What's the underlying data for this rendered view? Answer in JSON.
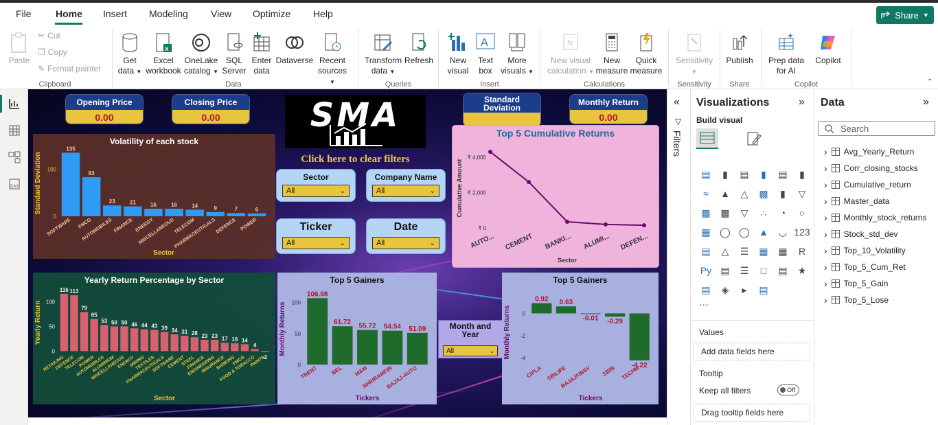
{
  "menu": {
    "items": [
      "File",
      "Home",
      "Insert",
      "Modeling",
      "View",
      "Optimize",
      "Help"
    ],
    "active": "Home",
    "share_label": "Share"
  },
  "ribbon": {
    "clipboard": {
      "paste": "Paste",
      "cut": "Cut",
      "copy": "Copy",
      "format_painter": "Format painter",
      "group": "Clipboard"
    },
    "data": {
      "get_data": "Get data",
      "excel": "Excel workbook",
      "onelake": "OneLake catalog",
      "sql": "SQL Server",
      "enter_data": "Enter data",
      "dataverse": "Dataverse",
      "recent": "Recent sources",
      "group": "Data"
    },
    "queries": {
      "transform": "Transform data",
      "refresh": "Refresh",
      "group": "Queries"
    },
    "insert": {
      "new_visual": "New visual",
      "text_box": "Text box",
      "more_visuals": "More visuals",
      "group": "Insert"
    },
    "calculations": {
      "new_visual_calc": "New visual calculation",
      "new_measure": "New measure",
      "quick_measure": "Quick measure",
      "group": "Calculations"
    },
    "sensitivity": {
      "label": "Sensitivity",
      "group": "Sensitivity"
    },
    "share": {
      "publish": "Publish",
      "group": "Share"
    },
    "copilot": {
      "prep": "Prep data for AI",
      "copilot": "Copilot",
      "group": "Copilot"
    }
  },
  "report": {
    "kpis": [
      {
        "title": "Opening Price",
        "value": "0.00"
      },
      {
        "title": "Closing Price",
        "value": "0.00"
      },
      {
        "title": "Standard Deviation",
        "value": ""
      },
      {
        "title": "Monthly Return",
        "value": "0.00"
      }
    ],
    "logo_text": "SMA",
    "clear_filters": "Click here to clear filters",
    "slicers": [
      {
        "title": "Sector",
        "value": "All"
      },
      {
        "title": "Company Name",
        "value": "All"
      },
      {
        "title": "Ticker",
        "value": "All"
      },
      {
        "title": "Date",
        "value": "All"
      }
    ],
    "month_year_slicer": {
      "title": "Month and Year",
      "value": "All"
    }
  },
  "chart_data": [
    {
      "type": "bar",
      "title": "Volatility of each stock",
      "xlabel": "Sector",
      "ylabel": "Standard Deviation",
      "categories": [
        "SOFTWARE",
        "FMCG",
        "AUTOMOBILES",
        "FINANCE",
        "ENERGY",
        "MISCELLANEOUS",
        "TELECOM",
        "PHARMACEUTICALS",
        "DEFENCE",
        "POWER"
      ],
      "values": [
        135,
        83,
        23,
        21,
        16,
        16,
        14,
        9,
        7,
        6
      ],
      "yticks": [
        "0",
        "100"
      ],
      "ylim": [
        0,
        140
      ]
    },
    {
      "type": "line",
      "title": "Top 5 Cumulative Returns",
      "xlabel": "Sector",
      "ylabel": "Cumulative Amount",
      "categories": [
        "AUTO...",
        "CEMENT",
        "BANKI...",
        "ALUMI...",
        "DEFEN..."
      ],
      "values": [
        4300,
        2600,
        350,
        200,
        150
      ],
      "yticks": [
        "₹ 0",
        "₹ 2,000",
        "₹ 4,000"
      ],
      "ylim": [
        0,
        4500
      ]
    },
    {
      "type": "bar",
      "title": "Yearly Return Percentage by Sector",
      "xlabel": "Sector",
      "ylabel": "Yearly Return",
      "categories": [
        "RETAILING",
        "DEFENCE",
        "TELECOM",
        "POWER",
        "AUTOMOBILES",
        "ALUMINIUM",
        "MISCELLANEOUS",
        "ENERGY",
        "MINING",
        "TEXTILES",
        "PHARMACEUTICALS",
        "SOFTWARE",
        "CEMENT",
        "STEEL",
        "FINANCE",
        "ENGINEERING",
        "INSURANCE",
        "BANKING",
        "FMCG",
        "FOOD & TOBACCO",
        "PAINTS"
      ],
      "values": [
        116,
        113,
        79,
        65,
        53,
        50,
        50,
        46,
        44,
        43,
        39,
        34,
        31,
        28,
        23,
        23,
        17,
        16,
        14,
        4,
        -2
      ],
      "yticks": [
        "0",
        "50",
        "100"
      ],
      "ylim": [
        -5,
        120
      ]
    },
    {
      "type": "bar",
      "title": "Top 5 Gainers",
      "xlabel": "Tickers",
      "ylabel": "Monthly Returns",
      "categories": [
        "TRENT",
        "BEL",
        "M&M",
        "SHRIRAMFIN",
        "BAJAJ-AUTO"
      ],
      "values": [
        106.98,
        61.72,
        55.72,
        54.54,
        51.09
      ],
      "yticks": [
        "0",
        "50",
        "100"
      ],
      "ylim": [
        0,
        115
      ]
    },
    {
      "type": "bar",
      "title": "Top 5 Gainers",
      "xlabel": "Tickers",
      "ylabel": "Monthly Returns",
      "categories": [
        "CIPLA",
        "SBILIFE",
        "BAJAJFINSV",
        "SBIN",
        "TECHM"
      ],
      "values": [
        0.92,
        0.63,
        -0.01,
        -0.29,
        -4.22
      ],
      "yticks": [
        "-4",
        "-2",
        "0"
      ],
      "ylim": [
        -4.6,
        1.2
      ]
    }
  ],
  "panes": {
    "filters": "Filters",
    "visualizations": {
      "title": "Visualizations",
      "build_visual": "Build visual",
      "values_label": "Values",
      "values_placeholder": "Add data fields here",
      "tooltip_label": "Tooltip",
      "keep_filters": "Keep all filters",
      "toggle": "Off",
      "tooltip_placeholder": "Drag tooltip fields here"
    },
    "data": {
      "title": "Data",
      "search_placeholder": "Search",
      "tables": [
        "Avg_Yearly_Return",
        "Corr_closing_stocks",
        "Cumulative_return",
        "Master_data",
        "Monthly_stock_returns",
        "Stock_std_dev",
        "Top_10_Volatility",
        "Top_5_Cum_Ret",
        "Top_5_Gain",
        "Top_5_Lose"
      ]
    }
  },
  "colors": {
    "accent": "#117865",
    "volatility_bar": "#2f9bf5",
    "yearly_bar": "#d9606e",
    "gainer_bar": "#1f6b2b",
    "cum_line": "#6a0a6e"
  }
}
